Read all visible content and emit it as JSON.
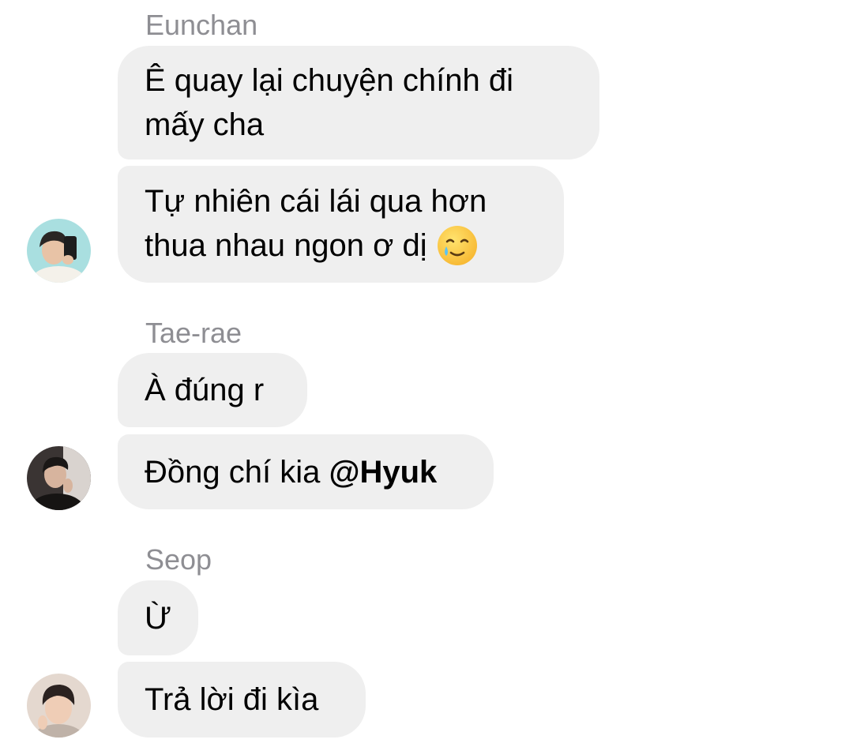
{
  "groups": [
    {
      "sender": "Eunchan",
      "messages": [
        {
          "lines": [
            "Ê quay lại chuyện chính đi",
            "mấy cha"
          ]
        },
        {
          "lines": [
            "Tự nhiên cái lái qua hơn",
            "thua nhau ngon ơ dị"
          ],
          "emoji": "smiling-face-with-tear-icon"
        }
      ],
      "avatar": "eunchan-avatar"
    },
    {
      "sender": "Tae-rae",
      "messages": [
        {
          "lines": [
            "À đúng r"
          ]
        },
        {
          "text": "Đồng chí kia ",
          "mention": "@Hyuk"
        }
      ],
      "avatar": "taerae-avatar"
    },
    {
      "sender": "Seop",
      "messages": [
        {
          "lines": [
            "Ừ"
          ]
        },
        {
          "lines": [
            "Trả lời đi kìa"
          ]
        }
      ],
      "avatar": "seop-avatar"
    }
  ],
  "colors": {
    "bubble": "#efefef",
    "sender_name": "#8e8e93",
    "text": "#000000",
    "background": "#ffffff"
  }
}
